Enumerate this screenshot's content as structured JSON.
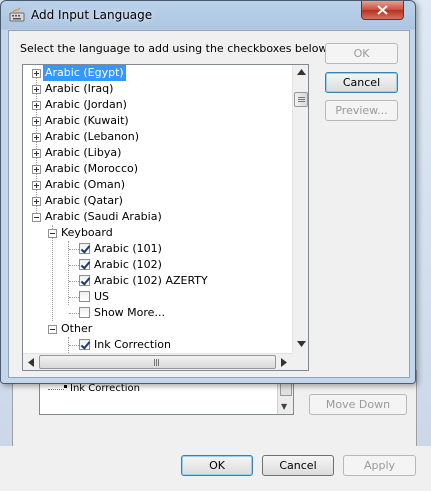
{
  "dialog": {
    "title": "Add Input Language",
    "prompt": "Select the language to add using the checkboxes below.",
    "buttons": {
      "ok": "OK",
      "cancel": "Cancel",
      "preview": "Preview..."
    }
  },
  "tree": {
    "languages": [
      "Arabic (Egypt)",
      "Arabic (Iraq)",
      "Arabic (Jordan)",
      "Arabic (Kuwait)",
      "Arabic (Lebanon)",
      "Arabic (Libya)",
      "Arabic (Morocco)",
      "Arabic (Oman)",
      "Arabic (Qatar)",
      "Arabic (Saudi Arabia)"
    ],
    "keyboard_group": "Keyboard",
    "keyboards": [
      {
        "label": "Arabic (101)",
        "checked": true
      },
      {
        "label": "Arabic (102)",
        "checked": true
      },
      {
        "label": "Arabic (102) AZERTY",
        "checked": true
      },
      {
        "label": "US",
        "checked": false
      },
      {
        "label": "Show More...",
        "checked": false
      }
    ],
    "other_group": "Other",
    "other": [
      {
        "label": "Ink Correction",
        "checked": true
      }
    ]
  },
  "background": {
    "list_item": "Ink Correction",
    "buttons": {
      "move_down": "Move Down",
      "ok": "OK",
      "cancel": "Cancel",
      "apply": "Apply"
    }
  },
  "colors": {
    "selection": "#3399ff",
    "close_button": "#c74f3b"
  }
}
